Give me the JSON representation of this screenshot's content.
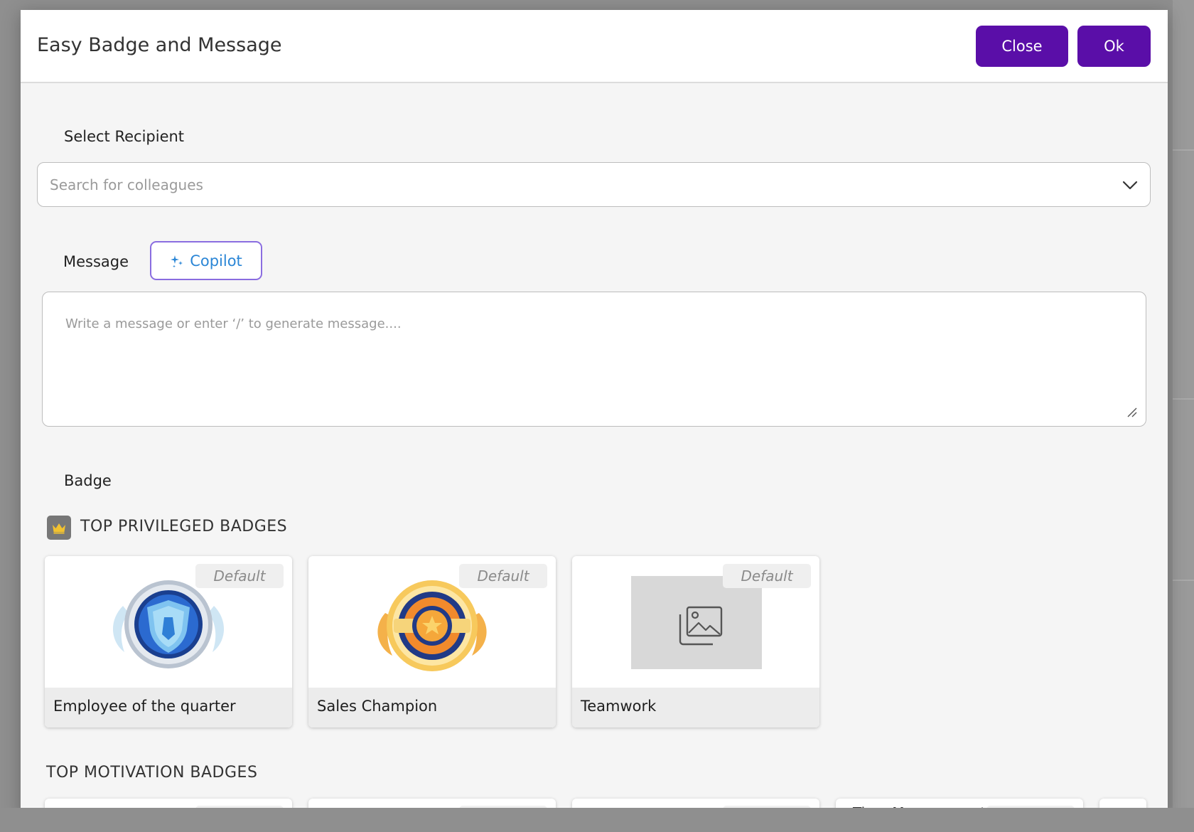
{
  "dialog": {
    "title": "Easy Badge and Message",
    "close_label": "Close",
    "ok_label": "Ok"
  },
  "recipient": {
    "label": "Select Recipient",
    "placeholder": "Search for colleagues"
  },
  "message": {
    "label": "Message",
    "copilot_label": "Copilot",
    "placeholder": "Write a message or enter ‘/’ to generate message...."
  },
  "badge": {
    "label": "Badge",
    "top_privileged_heading": "TOP PRIVILEGED BADGES",
    "top_motivation_heading": "TOP MOTIVATION BADGES",
    "default_tag": "Default",
    "privileged": [
      {
        "name": "Employee of the quarter",
        "icon": "shield-medal-icon"
      },
      {
        "name": "Sales Champion",
        "icon": "star-medal-icon"
      },
      {
        "name": "Teamwork",
        "icon": "image-placeholder-icon"
      }
    ],
    "motivation_partial_name": "Time Management"
  },
  "colors": {
    "primary": "#5a0ea8",
    "copilot_border": "#8a6de0",
    "copilot_text": "#2b86d6"
  }
}
